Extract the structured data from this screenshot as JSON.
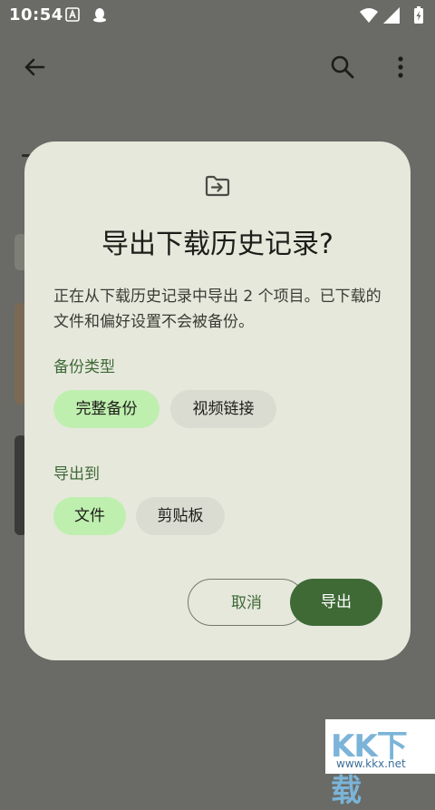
{
  "status_bar": {
    "time": "10:54"
  },
  "dialog": {
    "title": "导出下载历史记录?",
    "body": "正在从下载历史记录中导出 2 个项目。已下载的文件和偏好设置不会被备份。",
    "backup_type": {
      "label": "备份类型",
      "options": [
        "完整备份",
        "视频链接"
      ],
      "selected": "完整备份"
    },
    "export_to": {
      "label": "导出到",
      "options": [
        "文件",
        "剪贴板"
      ],
      "selected": "文件"
    },
    "cancel_label": "取消",
    "export_label": "导出"
  },
  "watermark": {
    "text": "KK下载",
    "url": "www.kkx.net"
  },
  "colors": {
    "accent": "#3f6a36",
    "chip_selected": "#bfefaf",
    "dialog_bg": "#e6e8dc",
    "scrim": "#6a6b66"
  }
}
